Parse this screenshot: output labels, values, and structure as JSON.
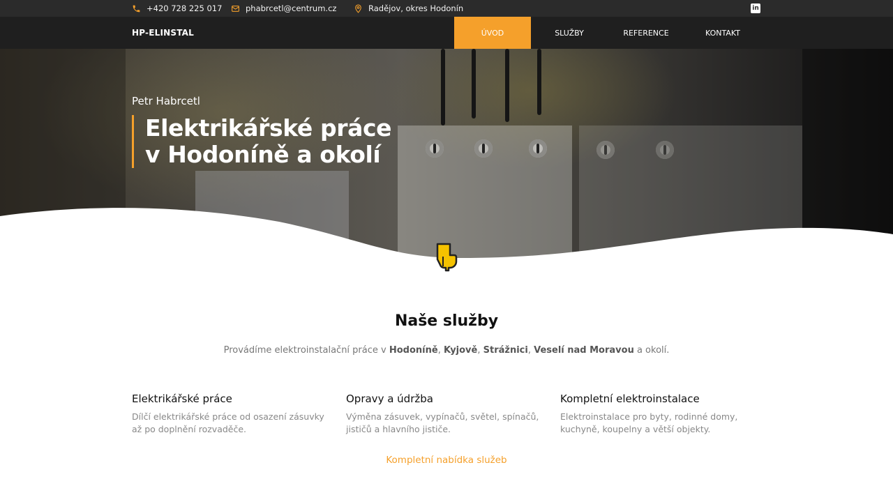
{
  "topbar": {
    "phone": "+420 728 225 017",
    "email": "phabrcetl@centrum.cz",
    "location": "Radějov, okres Hodonín",
    "linkedin_label": "in"
  },
  "nav": {
    "brand": "HP-ELINSTAL",
    "items": [
      {
        "label": "ÚVOD"
      },
      {
        "label": "SLUŽBY"
      },
      {
        "label": "REFERENCE"
      },
      {
        "label": "KONTAKT"
      }
    ]
  },
  "hero": {
    "subtitle": "Petr Habrcetl",
    "title_line1": "Elektrikářské práce",
    "title_line2": "v Hodoníně a okolí",
    "scroll_icon": "pointing-down-hand-icon"
  },
  "services": {
    "title": "Naše služby",
    "lead_prefix": "Provádíme elektroinstalační práce v ",
    "lead_towns": [
      "Hodoníně",
      "Kyjově",
      "Strážnici",
      "Veselí nad Moravou"
    ],
    "lead_sep": ", ",
    "lead_suffix": " a okolí.",
    "cards": [
      {
        "title": "Elektrikářské práce",
        "text": "Dílčí elektrikářské práce od osazení zásuvky až po doplnění rozvaděče."
      },
      {
        "title": "Opravy a údržba",
        "text": "Výměna zásuvek, vypínačů, světel, spínačů, jističů a hlavního jističe."
      },
      {
        "title": "Kompletní elektroinstalace",
        "text": "Elektroinstalace pro byty, rodinné domy, kuchyně, koupelny a větší objekty."
      }
    ],
    "more_link": "Kompletní nabídka služeb"
  },
  "colors": {
    "accent": "#f5a02b",
    "topbar_bg": "#2b2b2b",
    "nav_bg": "#1f1f1f"
  }
}
